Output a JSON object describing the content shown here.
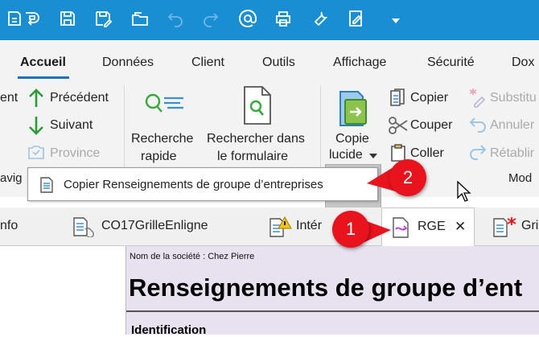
{
  "quick_access": {
    "icons": [
      "back-doc-icon",
      "sync-icon",
      "save-icon",
      "save-as-icon",
      "open-folder-icon",
      "undo-icon",
      "redo-icon",
      "at-icon",
      "print-icon",
      "wrench-icon",
      "edit-doc-icon",
      "dropdown-icon"
    ],
    "background": "#1a8ed3"
  },
  "menu": {
    "tabs": [
      "Accueil",
      "Données",
      "Client",
      "Outils",
      "Affichage",
      "Sécurité",
      "Dox"
    ],
    "active": "Accueil"
  },
  "ribbon": {
    "nav": {
      "partial_left": "ent",
      "previous": "Précédent",
      "next": "Suivant",
      "province": "Province",
      "group_partial": "avig"
    },
    "search": {
      "quick_line1": "Recherche",
      "quick_line2": "rapide",
      "form_line1": "Rechercher dans",
      "form_line2": "le formulaire"
    },
    "smart_copy": {
      "line1": "Copie",
      "line2": "lucide"
    },
    "clipboard": {
      "copy": "Copier",
      "cut": "Couper",
      "paste": "Coller"
    },
    "edit": {
      "substitute": "Substitu",
      "cancel": "Annuler",
      "restore": "Rétablir",
      "group_partial": "Mod"
    }
  },
  "tooltip": {
    "label": "Copier Renseignements de groupe d’entreprises"
  },
  "doc_tabs": {
    "items": [
      {
        "label": "nfo"
      },
      {
        "label": "CO17GrilleEnligne"
      },
      {
        "label": "Intér"
      },
      {
        "label": "RGE"
      },
      {
        "label": "Gri"
      }
    ],
    "active": "RGE",
    "close_symbol": "✕"
  },
  "document": {
    "company_line": "Nom de la société : Chez Pierre",
    "title": "Renseignements de groupe d’ent",
    "section": "Identification"
  },
  "markers": {
    "one": "1",
    "two": "2",
    "color": "#e8131d"
  }
}
